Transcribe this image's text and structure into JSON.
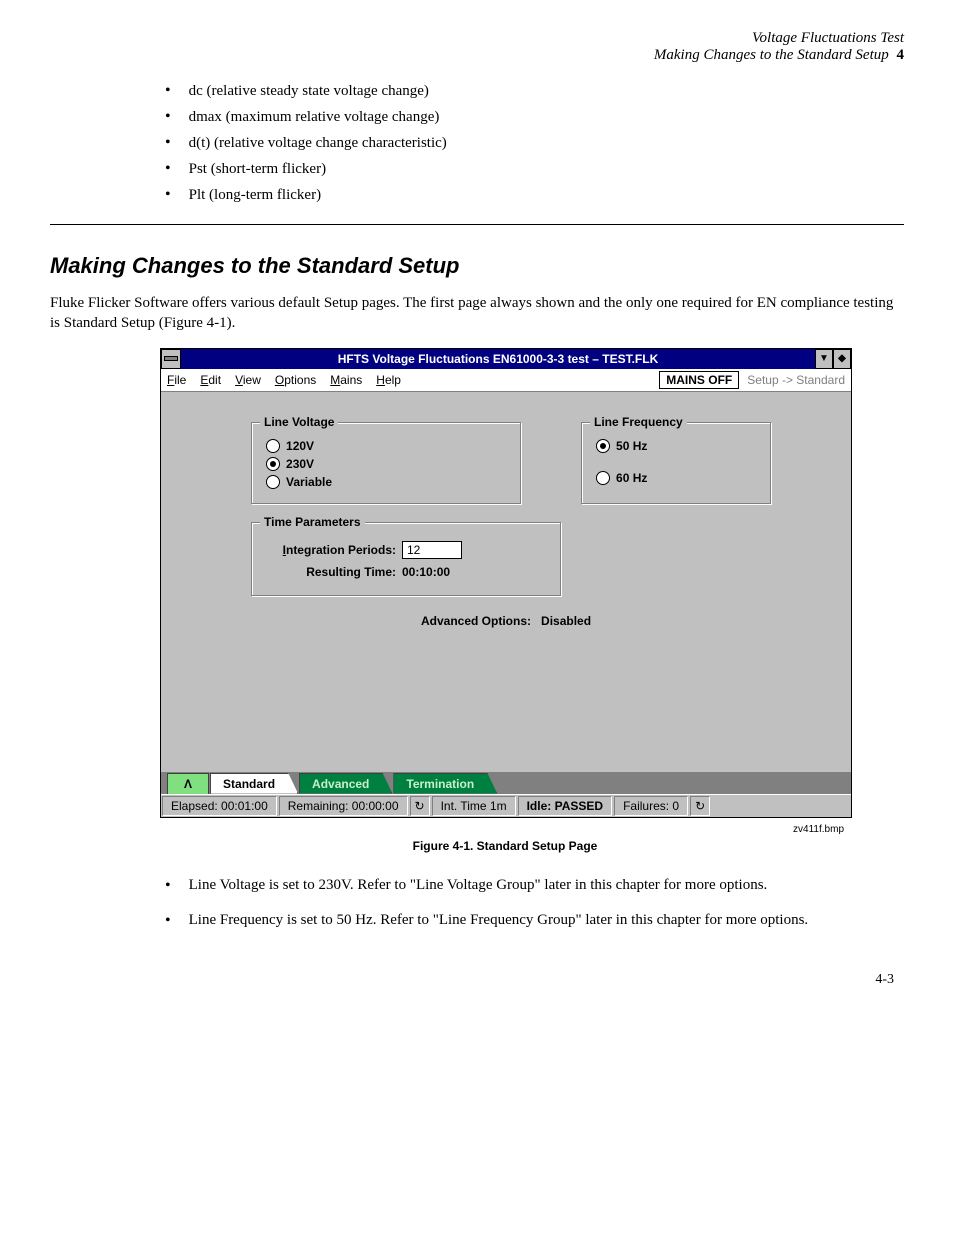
{
  "header": {
    "title_italic": "Voltage Fluctuations Test",
    "chapter": "4"
  },
  "top_bullets": [
    "dc (relative steady state voltage change)",
    "dmax (maximum relative voltage change)",
    "d(t) (relative voltage change characteristic)",
    "Pst (short-term flicker)",
    "Plt (long-term flicker)"
  ],
  "section_title": "Making Changes to the Standard Setup",
  "para1": "Fluke Flicker Software offers various default Setup pages. The first page always shown and the only one required for EN compliance testing is Standard Setup (Figure 4-1).",
  "window": {
    "title": "HFTS Voltage Fluctuations EN61000-3-3 test – TEST.FLK",
    "menus": [
      "File",
      "Edit",
      "View",
      "Options",
      "Mains",
      "Help"
    ],
    "menus_ul": [
      "F",
      "E",
      "V",
      "O",
      "M",
      "H"
    ],
    "mains_off": "MAINS OFF",
    "mode": "Setup -> Standard",
    "group_lv": "Line Voltage",
    "lv_options": [
      "120V",
      "230V",
      "Variable"
    ],
    "lv_ul": [
      "1",
      "2",
      "V"
    ],
    "lv_selected": 1,
    "group_lf": "Line Frequency",
    "lf_options": [
      "50 Hz",
      "60 Hz"
    ],
    "lf_ul": [
      "5",
      "6"
    ],
    "lf_selected": 0,
    "group_tp": "Time Parameters",
    "tp_int_label": "Integration Periods:",
    "tp_int_ul": "I",
    "tp_int_value": "12",
    "tp_res_label": "Resulting Time:",
    "tp_res_value": "00:10:00",
    "adv_label": "Advanced Options:",
    "adv_value": "Disabled",
    "tabs": {
      "first": "Λ",
      "standard": "Standard",
      "advanced": "Advanced",
      "termination": "Termination"
    },
    "status": {
      "elapsed": "Elapsed: 00:01:00",
      "remaining": "Remaining: 00:00:00",
      "inttime": "Int. Time 1m",
      "idle": "Idle: PASSED",
      "failures": "Failures: 0"
    }
  },
  "caption": "Figure 4-1. Standard Setup Page",
  "caption_code": "zv411f.bmp",
  "bottom_bullets": [
    "Line Voltage is set to 230V. Refer to \"Line Voltage Group\" later in this chapter for more options.",
    "Line Frequency is set to 50 Hz. Refer to \"Line Frequency Group\" later in this chapter for more options."
  ],
  "page_number": "4-3"
}
